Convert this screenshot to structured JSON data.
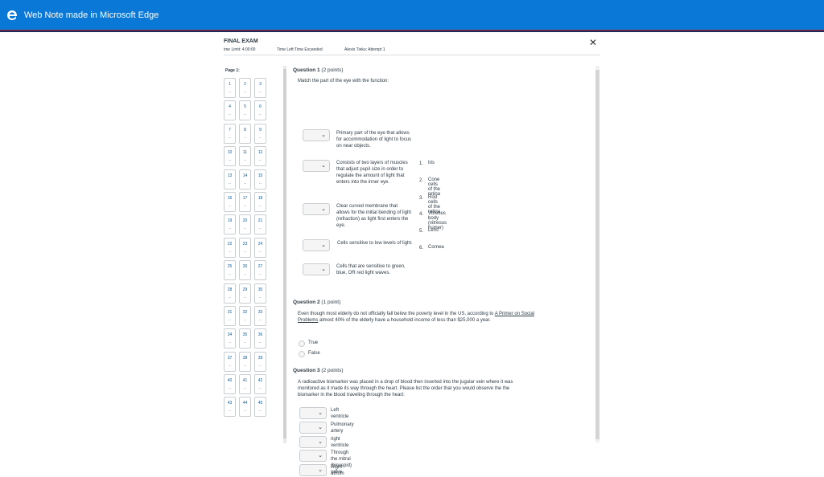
{
  "browser": {
    "title": "Web Note made in Microsoft Edge"
  },
  "exam": {
    "title": "FINAL EXAM",
    "time_limit": "ime Limit: 4:00:00",
    "time_left": "Time Left:Time Exceeded",
    "attempt": "Alexis Tieku: Attempt 1",
    "close_glyph": "✕"
  },
  "nav": {
    "page_label": "Page 1:",
    "questions": [
      "1",
      "2",
      "3",
      "4",
      "5",
      "6",
      "7",
      "8",
      "9",
      "10",
      "11",
      "12",
      "13",
      "14",
      "15",
      "16",
      "17",
      "18",
      "19",
      "20",
      "21",
      "22",
      "23",
      "24",
      "25",
      "26",
      "27",
      "28",
      "29",
      "30",
      "31",
      "32",
      "33",
      "34",
      "35",
      "36",
      "37",
      "38",
      "39",
      "40",
      "41",
      "42",
      "43",
      "44",
      "45"
    ],
    "placeholder": "--"
  },
  "q1": {
    "heading": "Question 1",
    "points": "(2 points)",
    "prompt": "Match the part of the eye with the function:",
    "items": [
      "Primary part of the eye that allows for accommodation of light to focus on near objects.",
      "Consists of two layers of muscles that adjust pupil size in order to regulate the amount of light that enters into the inner eye.",
      "Clear curved membrane that allows for the initial bending of light (refraction) as light first enters the eye.",
      "Cells sensitive to low levels of light.",
      "Cells that are sensitive to green, blue, OR red light waves."
    ],
    "options": [
      {
        "n": "1.",
        "label": "Iris"
      },
      {
        "n": "2.",
        "label": "Cone cells of the retina"
      },
      {
        "n": "3.",
        "label": "Rod cells of the retina"
      },
      {
        "n": "4.",
        "label": "Vitreous body (vitreous humer)"
      },
      {
        "n": "5.",
        "label": "Lens"
      },
      {
        "n": "6.",
        "label": "Cornea"
      }
    ]
  },
  "q2": {
    "heading": "Question 2",
    "points": "(1 point)",
    "prompt_a": "Even though most elderly do not officially fall below the poverty level in the US, according to",
    "prompt_link": "A Primer on Social Problems",
    "prompt_b": "almost 40% of the elderly have a household income of less than",
    "prompt_c": "$25,000 a year.",
    "choices": [
      "True",
      "False"
    ]
  },
  "q3": {
    "heading": "Question 3",
    "points": "(2 points)",
    "prompt": "A radioactive biomarker was placed in a drop of blood then inserted into the jugular vein where it was monitored as it made its way through the heart.  Please list the order that you would observe the the biomarker in the blood traveling through the heart:",
    "items": [
      "Left ventricle",
      "Pulmonary artery",
      "right ventricle",
      "Through the mitral (bicuspid) valve",
      "Right atrium"
    ]
  },
  "colors": {
    "topbar": "#0a78d7",
    "link": "#0a5a9c"
  }
}
